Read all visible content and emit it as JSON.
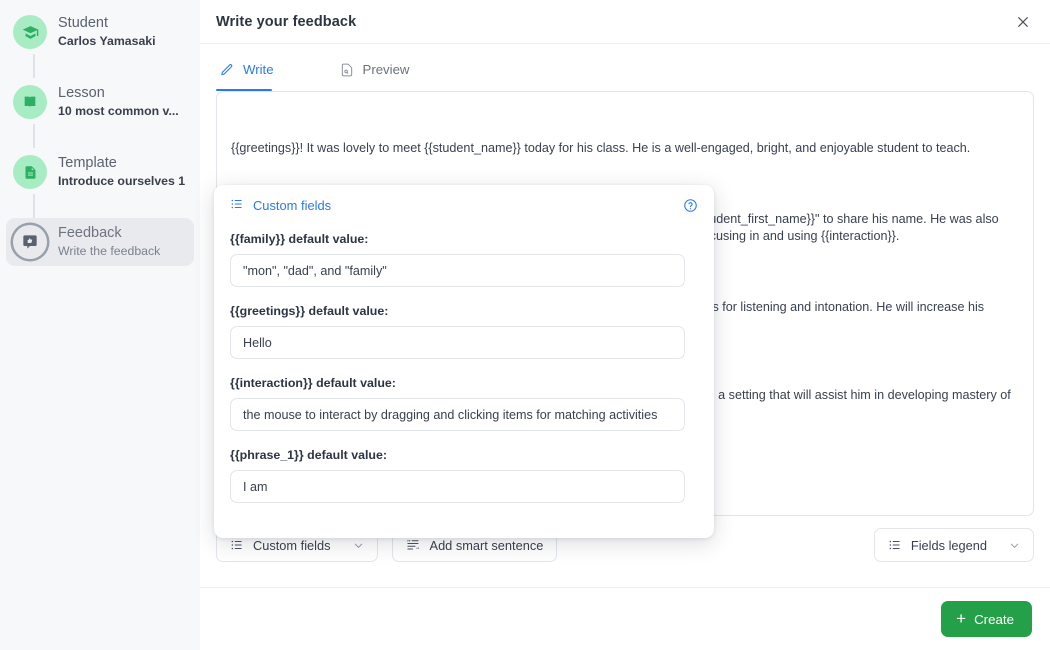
{
  "sidebar": {
    "steps": [
      {
        "icon": "graduation-cap-icon",
        "title": "Student",
        "subtitle": "Carlos Yamasaki",
        "active": false
      },
      {
        "icon": "open-book-icon",
        "title": "Lesson",
        "subtitle": "10 most common v...",
        "active": false
      },
      {
        "icon": "document-icon",
        "title": "Template",
        "subtitle": "Introduce ourselves 1",
        "active": false
      },
      {
        "icon": "feedback-icon",
        "title": "Feedback",
        "subtitle": "Write the feedback",
        "active": true
      }
    ]
  },
  "header": {
    "title": "Write your feedback",
    "close_icon": "close-icon"
  },
  "tabs": [
    {
      "label": "Write",
      "icon": "pencil-icon",
      "active": true
    },
    {
      "label": "Preview",
      "icon": "document-preview-icon",
      "active": false
    }
  ],
  "editor": {
    "paragraph_1": "{{greetings}}! It was lovely to meet {{student_name}} today for his class. He is a well-engaged, bright, and enjoyable student to teach.",
    "paragraph_2": "Today, {{student_name}} practiced {{subject}} by learning the phrase \"{{phrase_1}} {{student_first_name}}\" to share his name. He was also introduced to some of the lesson characters today. {{student_name}} did a great job focusing in and using {{interaction}}.",
    "paragraph_3": "We also introduced the student to natural intonation, phonics, and we sang some songs for listening and intonation. He will increase his knowledge of the songs.",
    "paragraph_4": "He did well with the material. With continued lessons, he will increase his vocabulary in a setting that will assist him in developing mastery of the language."
  },
  "toolbar": {
    "custom_fields_label": "Custom fields",
    "custom_fields_icon": "list-icon",
    "custom_fields_caret": "chevron-down-icon",
    "add_smart_sentence_label": "Add smart sentence",
    "add_smart_sentence_icon": "smart-text-icon",
    "fields_legend_label": "Fields legend",
    "fields_legend_icon": "list-icon",
    "fields_legend_caret": "chevron-down-icon"
  },
  "footer": {
    "create_label": "Create",
    "create_icon": "plus-icon",
    "create_color": "#24a148"
  },
  "popover": {
    "title": "Custom fields",
    "title_icon": "list-icon",
    "help_icon": "question-circle-icon",
    "fields": [
      {
        "label": "{{family}} default value:",
        "value": "\"mon\", \"dad\", and \"family\""
      },
      {
        "label": "{{greetings}} default value:",
        "value": "Hello"
      },
      {
        "label": "{{interaction}} default value:",
        "value": "the mouse to interact by dragging and clicking items for matching activities"
      },
      {
        "label": "{{phrase_1}} default value:",
        "value": "I am"
      }
    ]
  },
  "colors": {
    "accent_blue": "#2979f4",
    "sidebar_bg": "#f7f8fa",
    "step_icon_green": "#a8ecc3",
    "step_icon_green_dark": "#2faf63"
  }
}
